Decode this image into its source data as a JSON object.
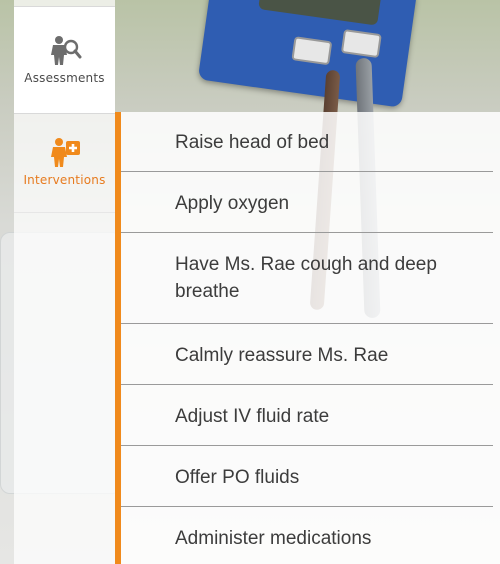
{
  "tabs": {
    "assessments": {
      "label": "Assessments",
      "icon": "assessment-magnifier-icon"
    },
    "interventions": {
      "label": "Interventions",
      "icon": "intervention-plus-icon",
      "active": true
    }
  },
  "accent_color": "#f08a1c",
  "interventions": [
    "Raise head of bed",
    "Apply oxygen",
    "Have Ms. Rae cough and deep breathe",
    "Calmly reassure Ms. Rae",
    "Adjust IV fluid rate",
    "Offer PO fluids",
    "Administer medications"
  ]
}
